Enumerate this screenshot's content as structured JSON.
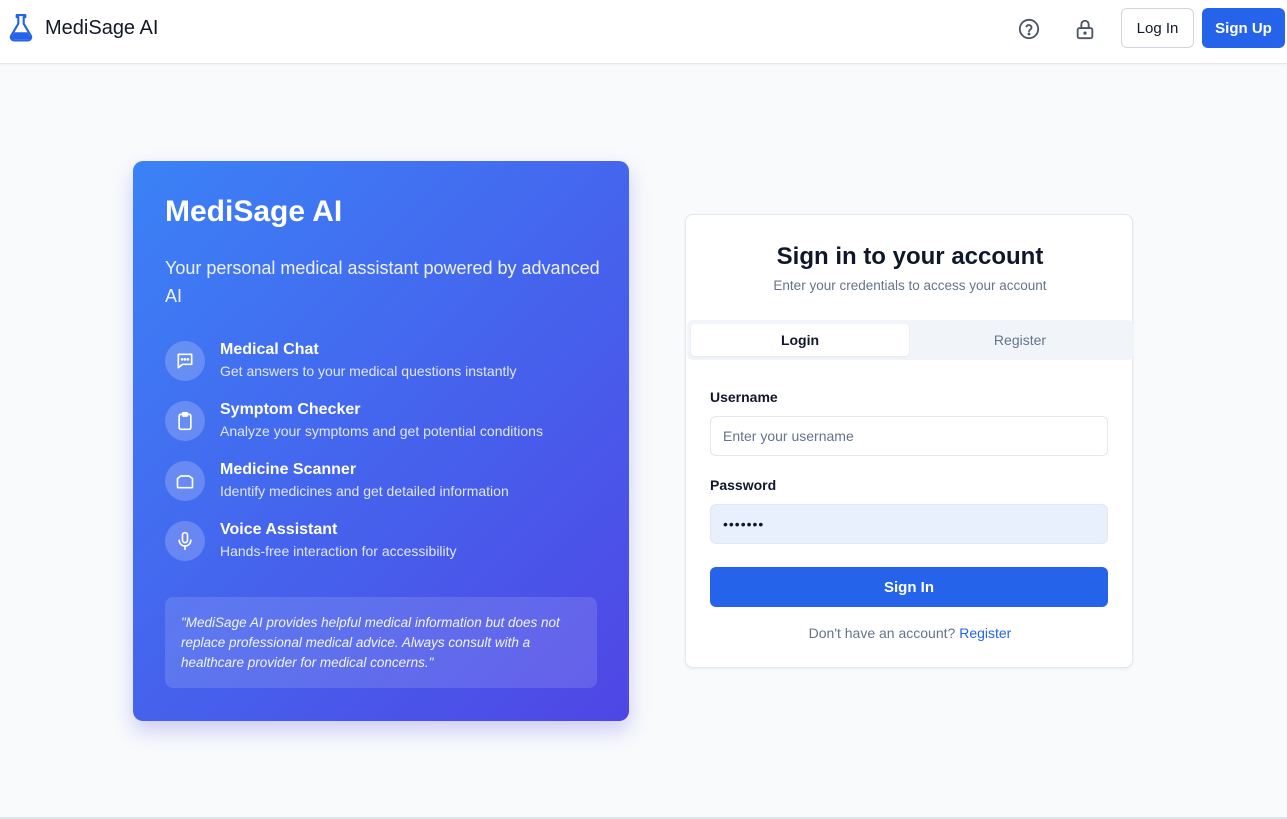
{
  "header": {
    "brand_name": "MediSage AI",
    "brand_icon": "flask-icon",
    "help_icon": "help-circle-icon",
    "lock_icon": "lock-icon",
    "login_label": "Log In",
    "signup_label": "Sign Up"
  },
  "hero": {
    "title": "MediSage AI",
    "subtitle": "Your personal medical assistant powered by advanced AI",
    "features": [
      {
        "icon": "chat-icon",
        "title": "Medical Chat",
        "desc": "Get answers to your medical questions instantly"
      },
      {
        "icon": "clipboard-icon",
        "title": "Symptom Checker",
        "desc": "Analyze your symptoms and get potential conditions"
      },
      {
        "icon": "scanner-icon",
        "title": "Medicine Scanner",
        "desc": "Identify medicines and get detailed information"
      },
      {
        "icon": "microphone-icon",
        "title": "Voice Assistant",
        "desc": "Hands-free interaction for accessibility"
      }
    ],
    "disclaimer": "\"MediSage AI provides helpful medical information but does not replace professional medical advice. Always consult with a healthcare provider for medical concerns.\""
  },
  "auth": {
    "title": "Sign in to your account",
    "subtitle": "Enter your credentials to access your account",
    "tabs": [
      "Login",
      "Register"
    ],
    "active_tab": "Login",
    "username_label": "Username",
    "username_placeholder": "Enter your username",
    "username_value": "",
    "password_label": "Password",
    "password_value": "•••••••",
    "signin_label": "Sign In",
    "footer_prompt": "Don't have an account?",
    "footer_link": "Register"
  },
  "colors": {
    "accent": "#2563eb",
    "gradient_start": "#3b82f6",
    "gradient_end": "#4f46e5"
  }
}
